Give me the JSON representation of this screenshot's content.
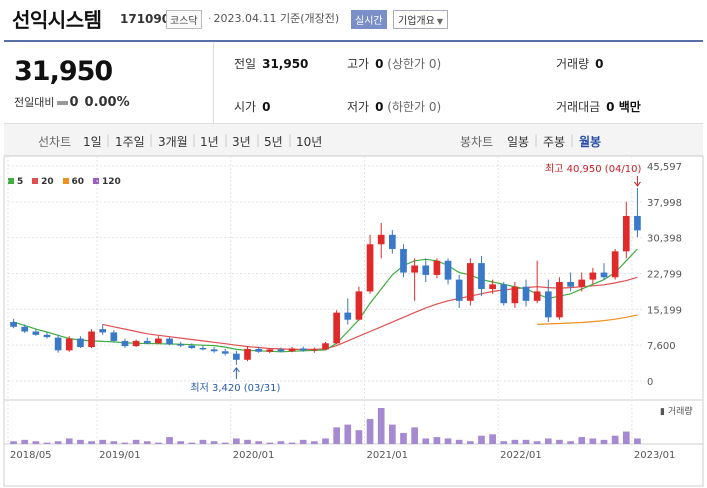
{
  "header": {
    "stock_name": "선익시스템",
    "stock_code": "171090",
    "market": "코스닥",
    "date": "2023.04.11",
    "date_suffix": "기준(개장전)",
    "realtime_label": "실시간",
    "company_info_label": "기업개요"
  },
  "quote": {
    "price": "31,950",
    "change_label": "전일대비",
    "change_value": "0",
    "change_pct": "0.00%",
    "prev_close_label": "전일",
    "prev_close": "31,950",
    "high_label": "고가",
    "high": "0",
    "high_limit": "(상한가 0)",
    "volume_label": "거래량",
    "volume": "0",
    "open_label": "시가",
    "open": "0",
    "low_label": "저가",
    "low": "0",
    "low_limit": "(하한가 0)",
    "amount_label": "거래대금",
    "amount": "0 백만"
  },
  "period_bar": {
    "line_chart_label": "선차트",
    "line_periods": [
      "1일",
      "1주일",
      "3개월",
      "1년",
      "3년",
      "5년",
      "10년"
    ],
    "candle_chart_label": "봉차트",
    "candle_periods": [
      "일봉",
      "주봉",
      "월봉"
    ],
    "selected": "월봉"
  },
  "colors": {
    "up": "#e02a2a",
    "down": "#3a78c8",
    "ma5": "#3fae3f",
    "ma20": "#e05050",
    "ma60": "#f09020",
    "ma120": "#9a5cc8",
    "volume": "#a58ad1",
    "accent": "#5a6ea8"
  },
  "chart_data": {
    "type": "candlestick",
    "legend": [
      {
        "name": "5",
        "color": "#3fae3f"
      },
      {
        "name": "20",
        "color": "#e05050"
      },
      {
        "name": "60",
        "color": "#f09020"
      },
      {
        "name": "120",
        "color": "#9a5cc8"
      }
    ],
    "y_ticks": [
      "45,597",
      "37,998",
      "30,398",
      "22,799",
      "15,199",
      "7,600",
      "0"
    ],
    "y_tick_values": [
      45597,
      37998,
      30398,
      22799,
      15199,
      7600,
      0
    ],
    "ylim": [
      0,
      45597
    ],
    "x_ticks": [
      {
        "label": "2018/05",
        "index": 0
      },
      {
        "label": "2019/01",
        "index": 8
      },
      {
        "label": "2020/01",
        "index": 20
      },
      {
        "label": "2021/01",
        "index": 32
      },
      {
        "label": "2022/01",
        "index": 44
      },
      {
        "label": "2023/01",
        "index": 56
      }
    ],
    "high_annotation": {
      "label": "최고",
      "value": "40,950",
      "date": "(04/10)"
    },
    "low_annotation": {
      "label": "최저",
      "value": "3,420",
      "date": "(03/31)"
    },
    "volume_label": "거래량",
    "candles": [
      {
        "o": 12500,
        "h": 13200,
        "l": 11200,
        "c": 11500
      },
      {
        "o": 11500,
        "h": 12000,
        "l": 10200,
        "c": 10500
      },
      {
        "o": 10500,
        "h": 11000,
        "l": 9600,
        "c": 9800
      },
      {
        "o": 9800,
        "h": 10300,
        "l": 9000,
        "c": 9300
      },
      {
        "o": 9200,
        "h": 9800,
        "l": 6000,
        "c": 6500
      },
      {
        "o": 6500,
        "h": 9500,
        "l": 6200,
        "c": 9000
      },
      {
        "o": 9000,
        "h": 9500,
        "l": 7000,
        "c": 7200
      },
      {
        "o": 7200,
        "h": 11000,
        "l": 7000,
        "c": 10500
      },
      {
        "o": 11000,
        "h": 12000,
        "l": 9800,
        "c": 10300
      },
      {
        "o": 10300,
        "h": 10800,
        "l": 8200,
        "c": 8500
      },
      {
        "o": 8500,
        "h": 9000,
        "l": 7000,
        "c": 7400
      },
      {
        "o": 7400,
        "h": 8800,
        "l": 7200,
        "c": 8500
      },
      {
        "o": 8500,
        "h": 9200,
        "l": 7800,
        "c": 8000
      },
      {
        "o": 8000,
        "h": 9500,
        "l": 7800,
        "c": 9000
      },
      {
        "o": 9000,
        "h": 9300,
        "l": 7600,
        "c": 7800
      },
      {
        "o": 7800,
        "h": 8300,
        "l": 7200,
        "c": 7500
      },
      {
        "o": 7500,
        "h": 8000,
        "l": 6800,
        "c": 7000
      },
      {
        "o": 7000,
        "h": 7600,
        "l": 6500,
        "c": 6700
      },
      {
        "o": 6700,
        "h": 7200,
        "l": 6000,
        "c": 6300
      },
      {
        "o": 6300,
        "h": 6800,
        "l": 5400,
        "c": 5800
      },
      {
        "o": 5800,
        "h": 6400,
        "l": 3420,
        "c": 4500
      },
      {
        "o": 4500,
        "h": 7400,
        "l": 4200,
        "c": 6800
      },
      {
        "o": 6800,
        "h": 7300,
        "l": 6000,
        "c": 6200
      },
      {
        "o": 6200,
        "h": 7000,
        "l": 5900,
        "c": 6700
      },
      {
        "o": 6700,
        "h": 7100,
        "l": 6100,
        "c": 6300
      },
      {
        "o": 6300,
        "h": 7200,
        "l": 6100,
        "c": 6900
      },
      {
        "o": 6900,
        "h": 7300,
        "l": 6200,
        "c": 6500
      },
      {
        "o": 6500,
        "h": 7100,
        "l": 6000,
        "c": 6700
      },
      {
        "o": 6700,
        "h": 8300,
        "l": 6500,
        "c": 8000
      },
      {
        "o": 8000,
        "h": 15000,
        "l": 7800,
        "c": 14500
      },
      {
        "o": 14500,
        "h": 17500,
        "l": 12000,
        "c": 13000
      },
      {
        "o": 13000,
        "h": 20000,
        "l": 12800,
        "c": 19000
      },
      {
        "o": 19000,
        "h": 31000,
        "l": 18500,
        "c": 29000
      },
      {
        "o": 29000,
        "h": 33500,
        "l": 26000,
        "c": 31000
      },
      {
        "o": 31000,
        "h": 32000,
        "l": 27000,
        "c": 28000
      },
      {
        "o": 28000,
        "h": 29000,
        "l": 22000,
        "c": 23000
      },
      {
        "o": 23000,
        "h": 26000,
        "l": 17000,
        "c": 24500
      },
      {
        "o": 24500,
        "h": 26000,
        "l": 21000,
        "c": 22500
      },
      {
        "o": 22500,
        "h": 26000,
        "l": 21800,
        "c": 25500
      },
      {
        "o": 25500,
        "h": 26000,
        "l": 20500,
        "c": 21500
      },
      {
        "o": 21500,
        "h": 22500,
        "l": 15500,
        "c": 17000
      },
      {
        "o": 17000,
        "h": 26000,
        "l": 16000,
        "c": 25000
      },
      {
        "o": 25000,
        "h": 26500,
        "l": 18000,
        "c": 19500
      },
      {
        "o": 19500,
        "h": 21500,
        "l": 18500,
        "c": 20500
      },
      {
        "o": 20500,
        "h": 21000,
        "l": 16000,
        "c": 16500
      },
      {
        "o": 16500,
        "h": 21000,
        "l": 15500,
        "c": 20000
      },
      {
        "o": 20000,
        "h": 21500,
        "l": 15800,
        "c": 17000
      },
      {
        "o": 17000,
        "h": 25500,
        "l": 16500,
        "c": 19000
      },
      {
        "o": 19000,
        "h": 21500,
        "l": 12500,
        "c": 13500
      },
      {
        "o": 13500,
        "h": 22000,
        "l": 13000,
        "c": 21000
      },
      {
        "o": 21000,
        "h": 23000,
        "l": 19000,
        "c": 20000
      },
      {
        "o": 20000,
        "h": 23000,
        "l": 19000,
        "c": 21500
      },
      {
        "o": 21500,
        "h": 24000,
        "l": 20500,
        "c": 23000
      },
      {
        "o": 23000,
        "h": 25000,
        "l": 21500,
        "c": 22000
      },
      {
        "o": 22000,
        "h": 28000,
        "l": 21500,
        "c": 27500
      },
      {
        "o": 27500,
        "h": 38000,
        "l": 26000,
        "c": 35000
      },
      {
        "o": 35000,
        "h": 40950,
        "l": 30500,
        "c": 31950
      }
    ],
    "volumes": [
      2,
      3,
      2,
      1,
      2,
      4,
      3,
      2,
      3,
      2,
      1,
      3,
      2,
      1,
      5,
      2,
      1,
      3,
      2,
      1,
      4,
      3,
      2,
      1,
      2,
      1,
      3,
      2,
      4,
      12,
      14,
      10,
      18,
      26,
      14,
      8,
      12,
      4,
      5,
      4,
      3,
      2,
      6,
      7,
      2,
      3,
      3,
      2,
      4,
      3,
      2,
      5,
      4,
      3,
      6,
      9,
      4
    ],
    "ma5": [
      12500,
      11800,
      11000,
      10400,
      9700,
      9000,
      8700,
      8500,
      8400,
      8300,
      8100,
      8000,
      7950,
      7900,
      7850,
      7800,
      7700,
      7600,
      7500,
      7200,
      6700,
      6500,
      6400,
      6300,
      6200,
      6300,
      6400,
      6500,
      6600,
      8000,
      10500,
      13000,
      16500,
      19500,
      22500,
      24500,
      25500,
      25800,
      25500,
      24500,
      23000,
      22500,
      21500,
      21000,
      20500,
      20000,
      19500,
      18500,
      17500,
      18000,
      18500,
      19500,
      20500,
      21500,
      23000,
      25500,
      28000
    ],
    "ma20": [
      null,
      null,
      null,
      null,
      null,
      null,
      null,
      null,
      12000,
      11500,
      11000,
      10500,
      10000,
      9700,
      9400,
      9100,
      8800,
      8500,
      8200,
      7900,
      7600,
      7300,
      7100,
      6900,
      6800,
      6700,
      6700,
      6700,
      6800,
      7500,
      8500,
      9500,
      10500,
      11500,
      12500,
      13500,
      14500,
      15500,
      16300,
      17000,
      17500,
      18000,
      18500,
      19000,
      19300,
      19600,
      19800,
      20000,
      19800,
      19700,
      19800,
      20000,
      20200,
      20400,
      20800,
      21300,
      22000
    ],
    "ma60": [
      null,
      null,
      null,
      null,
      null,
      null,
      null,
      null,
      null,
      null,
      null,
      null,
      null,
      null,
      null,
      null,
      null,
      null,
      null,
      null,
      null,
      null,
      null,
      null,
      null,
      null,
      null,
      null,
      null,
      null,
      null,
      null,
      null,
      null,
      null,
      null,
      null,
      null,
      null,
      null,
      null,
      null,
      null,
      null,
      null,
      null,
      null,
      12000,
      12100,
      12200,
      12300,
      12400,
      12600,
      12800,
      13100,
      13500,
      14000
    ],
    "ma120": []
  }
}
